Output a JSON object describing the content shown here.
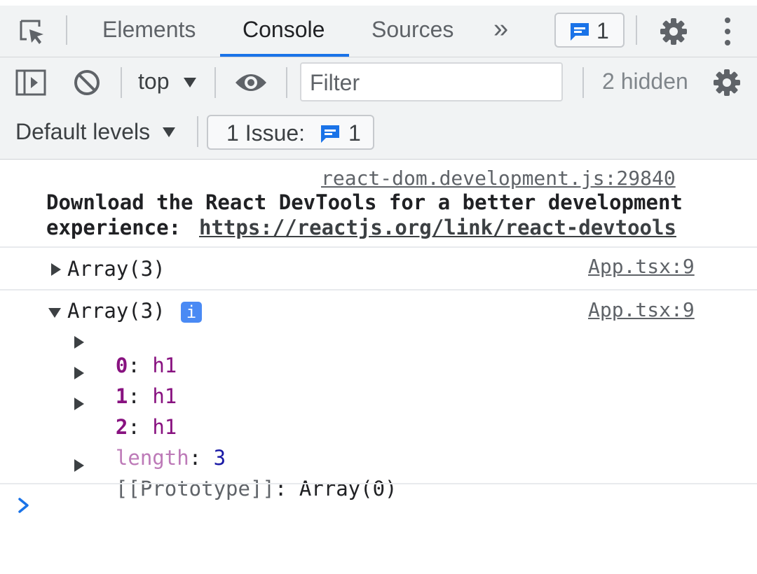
{
  "tabs": {
    "elements": "Elements",
    "console": "Console",
    "sources": "Sources",
    "more": "»",
    "issues_count": "1"
  },
  "toolbar": {
    "context": "top",
    "filter_placeholder": "Filter",
    "hidden": "2 hidden",
    "levels": "Default levels",
    "issues_prefix": "1 Issue:",
    "issues_count": "1"
  },
  "console": {
    "messages": [
      {
        "source": "react-dom.development.js:29840",
        "text_line1": "Download the React DevTools for a better development",
        "text_line2_prefix": "experience: ",
        "link": "https://reactjs.org/link/react-devtools"
      },
      {
        "source": "App.tsx:9",
        "label": "Array(3)"
      },
      {
        "source": "App.tsx:9",
        "label": "Array(3)",
        "info_badge": "i",
        "items": [
          {
            "key": "0",
            "value": "h1"
          },
          {
            "key": "1",
            "value": "h1"
          },
          {
            "key": "2",
            "value": "h1"
          }
        ],
        "length_key": "length",
        "length_value": "3",
        "prototype_key": "[[Prototype]]",
        "prototype_value": "Array(0)"
      }
    ],
    "prompt": "›"
  },
  "colors": {
    "accent": "#1a73e8",
    "object_key": "#881280",
    "number": "#1a1aa6"
  },
  "icons": [
    "inspect-icon",
    "chat-icon",
    "gear-icon",
    "kebab-icon",
    "sidebar-icon",
    "clear-icon",
    "eye-icon",
    "chevron-down-icon",
    "expand-triangle-icon",
    "info-icon",
    "prompt-chevron-icon"
  ]
}
